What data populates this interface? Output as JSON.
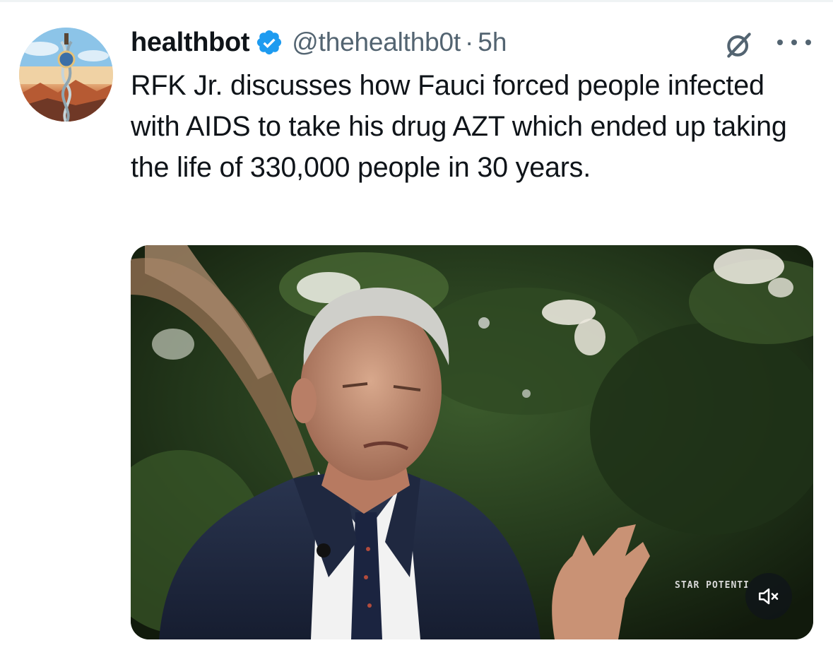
{
  "tweet": {
    "display_name": "healthbot",
    "handle": "@thehealthb0t",
    "separator": "·",
    "timestamp": "5h",
    "text": "RFK Jr. discusses how Fauci forced people infected with AIDS to take his drug AZT which ended up taking the life of 330,000 people in 30 years.",
    "verified": true
  },
  "media": {
    "type": "video",
    "watermark": "STAR POTENTI",
    "muted": true,
    "icon": "speaker-muted-icon"
  },
  "icons": {
    "verified": "verified-badge-icon",
    "grok": "grok-icon",
    "more": "more-options-icon"
  },
  "colors": {
    "text_primary": "#0f1419",
    "text_secondary": "#536471",
    "verified_blue": "#1d9bf0",
    "divider": "#eff3f4"
  }
}
